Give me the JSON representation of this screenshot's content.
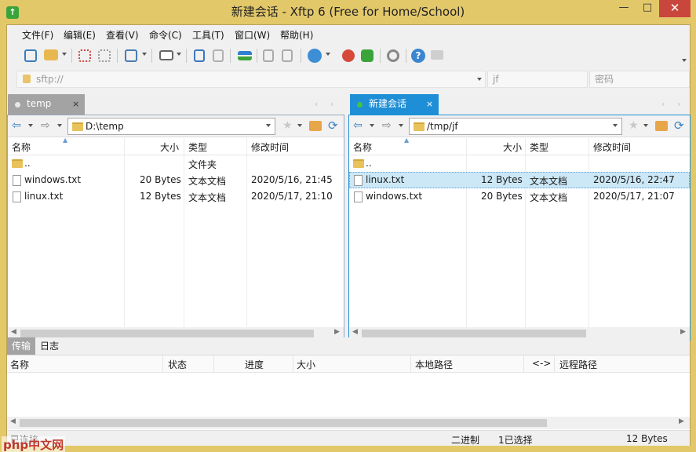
{
  "window": {
    "title": "新建会话 - Xftp 6 (Free for Home/School)",
    "app_icon_glyph": "↑",
    "minimize": "—",
    "maximize": "□",
    "close": "✕"
  },
  "menu": [
    "文件(F)",
    "编辑(E)",
    "查看(V)",
    "命令(C)",
    "工具(T)",
    "窗口(W)",
    "帮助(H)"
  ],
  "address": {
    "url_placeholder": "sftp://",
    "user_value": "jf",
    "password_placeholder": "密码"
  },
  "local": {
    "tab_label": "temp",
    "tab_close": "×",
    "path": "D:\\temp",
    "columns": [
      "名称",
      "大小",
      "类型",
      "修改时间"
    ],
    "rows": [
      {
        "name": "..",
        "size": "",
        "type": "文件夹",
        "modified": ""
      },
      {
        "name": "windows.txt",
        "size": "20 Bytes",
        "type": "文本文档",
        "modified": "2020/5/16, 21:45"
      },
      {
        "name": "linux.txt",
        "size": "12 Bytes",
        "type": "文本文档",
        "modified": "2020/5/17, 21:10"
      }
    ]
  },
  "remote": {
    "tab_label": "新建会话",
    "tab_close": "×",
    "path": "/tmp/jf",
    "columns": [
      "名称",
      "大小",
      "类型",
      "修改时间"
    ],
    "rows": [
      {
        "name": "..",
        "size": "",
        "type": "",
        "modified": ""
      },
      {
        "name": "linux.txt",
        "size": "12 Bytes",
        "type": "文本文档",
        "modified": "2020/5/16, 22:47"
      },
      {
        "name": "windows.txt",
        "size": "20 Bytes",
        "type": "文本文档",
        "modified": "2020/5/17, 21:07"
      }
    ]
  },
  "transfer": {
    "tabs": [
      "传输",
      "日志"
    ],
    "columns": [
      "名称",
      "状态",
      "进度",
      "大小",
      "本地路径",
      "<->",
      "远程路径"
    ]
  },
  "status": {
    "left": "已连接",
    "mode": "二进制",
    "selected": "1已选择",
    "size": "12 Bytes"
  },
  "watermark": "php中文网",
  "colors": {
    "title_bg": "#e3c86a",
    "close_bg": "#c9463d",
    "active_tab": "#1e8fd6",
    "selected_row": "#cce8f7"
  }
}
